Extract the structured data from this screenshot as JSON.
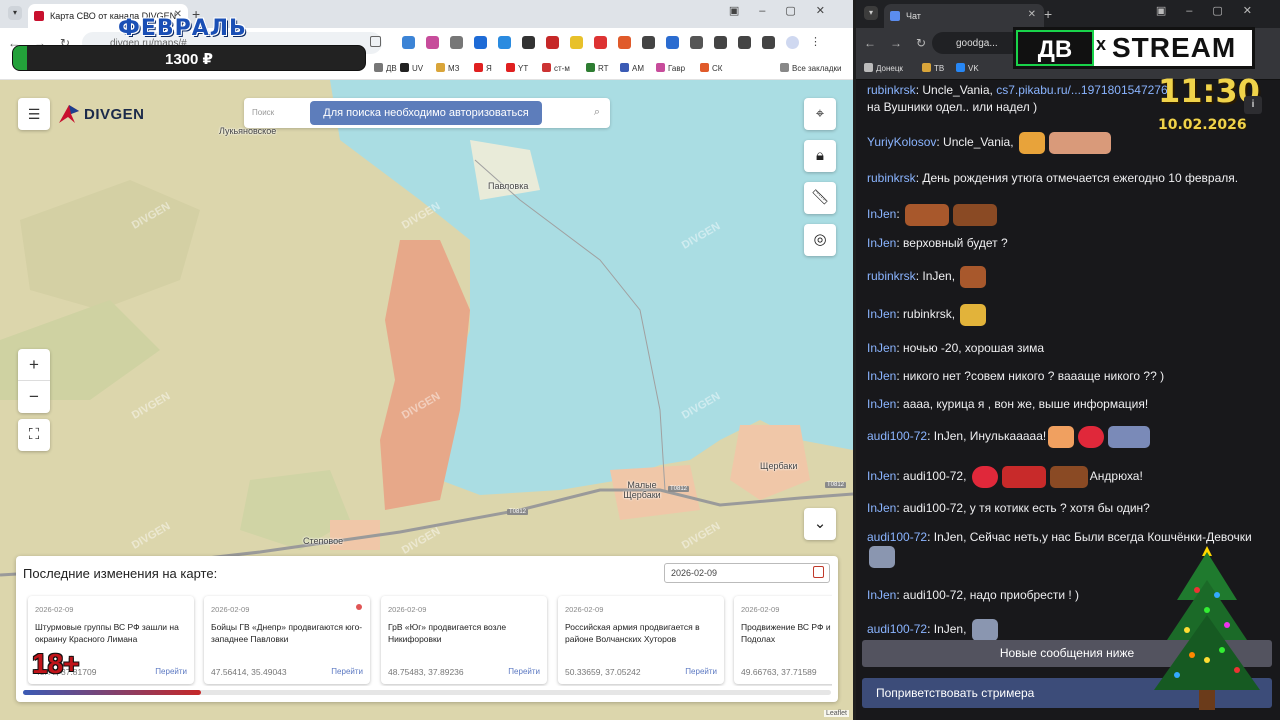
{
  "left_browser": {
    "tab_title": "Карта СВО от канала DIVGEN",
    "url": "divgen.ru/maps/#",
    "bookmarks": [
      "ДВ",
      "UV",
      "МЗ",
      "Я",
      "YT",
      "ст-м",
      "RT",
      "АМ",
      "Гавр",
      "СК",
      "Все закладки"
    ]
  },
  "overlay": {
    "month": "ФЕВРАЛЬ",
    "price": "1300 ₽",
    "price_progress": 0.04,
    "age_rating": "18+"
  },
  "map": {
    "logo": "DIVGEN",
    "search_placeholder": "Поиск",
    "search_warning": "Для поиска необходимо авторизоваться",
    "places": [
      "Лукьяновское",
      "Павловка",
      "Малые Щербаки",
      "Щербаки",
      "Степовое"
    ],
    "roads": [
      "T0812",
      "T0812",
      "T0812"
    ],
    "watermark": "DIVGEN",
    "attribution": "Leaflet"
  },
  "changes_panel": {
    "title": "Последние изменения на карте:",
    "date_value": "2026-02-09",
    "scroll_progress": 0.22,
    "cards": [
      {
        "date": "2026-02-09",
        "text": "Штурмовые группы ВС РФ зашли на окраину Красного Лимана",
        "coords": "48.??, 37.81709",
        "link": "Перейти",
        "dot": false
      },
      {
        "date": "2026-02-09",
        "text": "Бойцы ГВ «Днепр» продвигаются юго-западнее Павловки",
        "coords": "47.56414, 35.49043",
        "link": "Перейти",
        "dot": true
      },
      {
        "date": "2026-02-09",
        "text": "ГрВ «Юг» продвигается возле Никифоровки",
        "coords": "48.75483, 37.89236",
        "link": "Перейти",
        "dot": false
      },
      {
        "date": "2026-02-09",
        "text": "Российская армия продвигается в районе Волчанских Хуторов",
        "coords": "50.33659, 37.05242",
        "link": "Перейти",
        "dot": false
      },
      {
        "date": "2026-02-09",
        "text": "Продвижение ВС РФ и Подолах",
        "coords": "49.66763, 37.71589",
        "link": "Перейти",
        "dot": false
      }
    ]
  },
  "right_browser": {
    "tab_title": "Чат",
    "url": "goodga...",
    "bookmarks": [
      "Донецк",
      "ТВ",
      "VK"
    ]
  },
  "stream_logo": {
    "left": "ДВ",
    "x": "x",
    "right": "STREAM"
  },
  "clock": {
    "time": "11:30",
    "date": "10.02.2026"
  },
  "chat": {
    "messages": [
      {
        "user": "rubinkrsk",
        "text": "Uncle_Vania, ",
        "link": "cs7.pikabu.ru/...1971801547276",
        "text2": "на Вушники одел.. или надел )",
        "color": "#8ab4ff"
      },
      {
        "user": "YuriyKolosov",
        "text": "Uncle_Vania, ",
        "color": "#8ab4ff"
      },
      {
        "user": "rubinkrsk",
        "text": "День рождения утюга отмечается ежегодно 10 февраля.",
        "color": "#8ab4ff"
      },
      {
        "user": "InJen",
        "text": "",
        "color": "#8ab4ff"
      },
      {
        "user": "InJen",
        "text": "верховный будет ?",
        "color": "#8ab4ff"
      },
      {
        "user": "rubinkrsk",
        "text": "InJen, ",
        "color": "#8ab4ff"
      },
      {
        "user": "InJen",
        "text": "rubinkrsk, ",
        "color": "#8ab4ff"
      },
      {
        "user": "InJen",
        "text": "ночью -20, хорошая зима",
        "color": "#8ab4ff"
      },
      {
        "user": "InJen",
        "text": "никого нет ?совем никого ? вааащe никого ?? )",
        "color": "#8ab4ff"
      },
      {
        "user": "InJen",
        "text": "аааа, курица я , вон же, выше информация!",
        "color": "#8ab4ff"
      },
      {
        "user": "audi100-72",
        "text": "InJen, Инулькааааа!",
        "color": "#8ab4ff"
      },
      {
        "user": "InJen",
        "text": "audi100-72, ",
        "text2": "Андрюха!",
        "color": "#8ab4ff"
      },
      {
        "user": "InJen",
        "text": "audi100-72, у тя котикк есть ? хотя бы один?",
        "color": "#8ab4ff"
      },
      {
        "user": "audi100-72",
        "text": "InJen, Сейчас неть,у нас Были всегда Кошчёнки-Девочки",
        "color": "#8ab4ff"
      },
      {
        "user": "InJen",
        "text": "audi100-72, надо приобрести ! )",
        "color": "#8ab4ff"
      },
      {
        "user": "audi100-72",
        "text": "InJen, ",
        "color": "#8ab4ff"
      }
    ],
    "new_messages_label": "Новые сообщения ниже",
    "greet_label": "Поприветствовать стримера"
  }
}
